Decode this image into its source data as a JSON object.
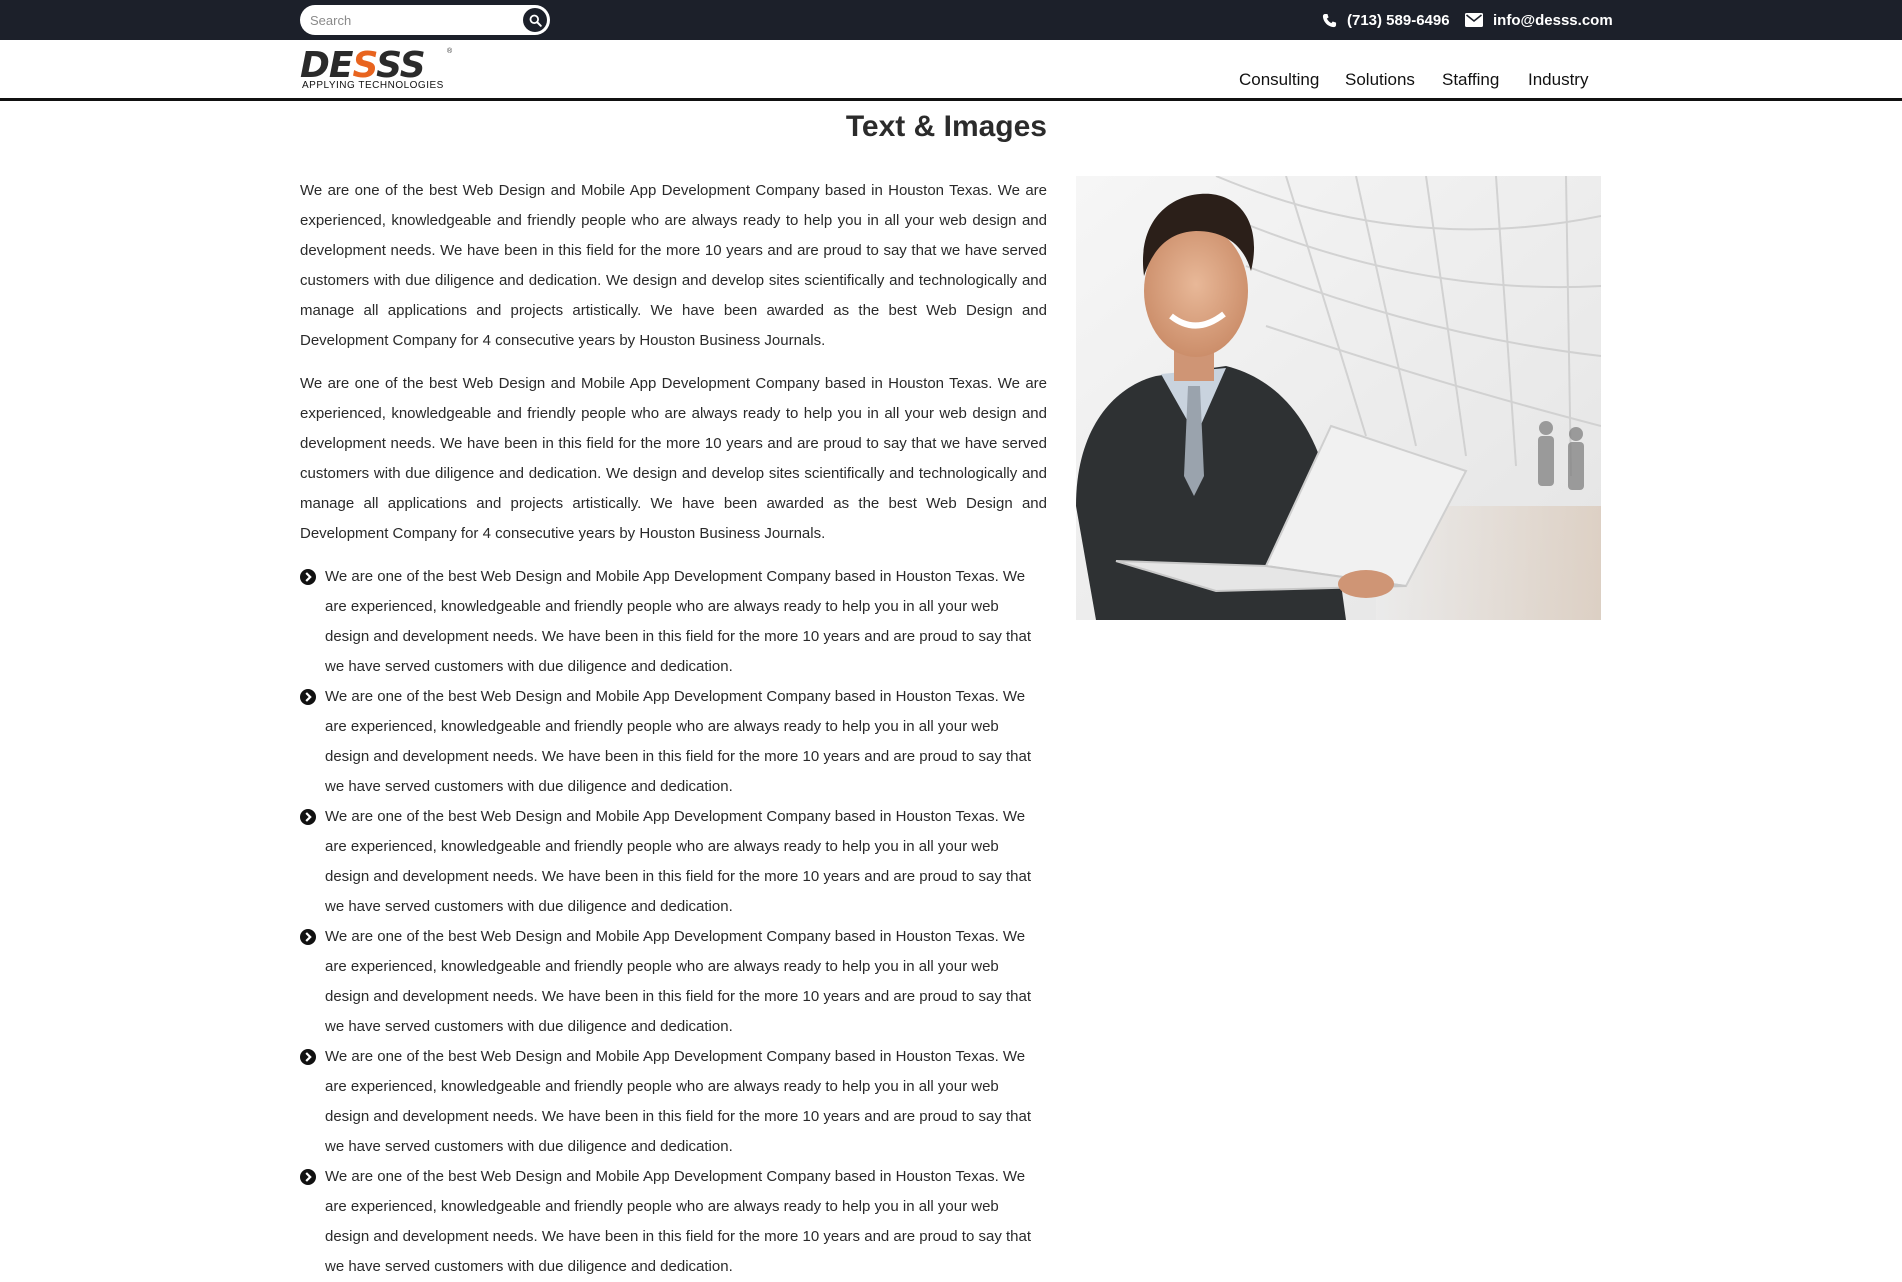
{
  "topbar": {
    "search": {
      "placeholder": "Search",
      "value": ""
    },
    "phone": "(713) 589-6496",
    "email": "info@desss.com"
  },
  "header": {
    "logo": {
      "word_main": "DE",
      "word_accent": "S",
      "word_rest": "SS",
      "tagline": "APPLYING TECHNOLOGIES",
      "reg": "®"
    },
    "nav": [
      "Consulting",
      "Solutions",
      "Staffing",
      "Industry"
    ]
  },
  "main": {
    "title": "Text & Images",
    "paragraphs": [
      "We are one of the best Web Design and Mobile App Development Company based in Houston Texas. We are experienced, knowledgeable and friendly people who are always ready to help you in all your web design and development needs. We have been in this field for the more 10 years and are proud to say that we have served customers with due diligence and dedication. We design and develop sites scientifically and technologically and manage all applications and projects artistically. We have been awarded as the best Web Design and Development Company for 4 consecutive years by Houston Business Journals.",
      "We are one of the best Web Design and Mobile App Development Company based in Houston Texas. We are experienced, knowledgeable and friendly people who are always ready to help you in all your web design and development needs. We have been in this field for the more 10 years and are proud to say that we have served customers with due diligence and dedication. We design and develop sites scientifically and technologically and manage all applications and projects artistically. We have been awarded as the best Web Design and Development Company for 4 consecutive years by Houston Business Journals."
    ],
    "bullets": [
      "We are one of the best Web Design and Mobile App Development Company based in Houston Texas. We are experienced, knowledgeable and friendly people who are always ready to help you in all your web design and development needs. We have been in this field for the more 10 years and are proud to say that we have served customers with due diligence and dedication.",
      "We are one of the best Web Design and Mobile App Development Company based in Houston Texas. We are experienced, knowledgeable and friendly people who are always ready to help you in all your web design and development needs. We have been in this field for the more 10 years and are proud to say that we have served customers with due diligence and dedication.",
      "We are one of the best Web Design and Mobile App Development Company based in Houston Texas. We are experienced, knowledgeable and friendly people who are always ready to help you in all your web design and development needs. We have been in this field for the more 10 years and are proud to say that we have served customers with due diligence and dedication.",
      "We are one of the best Web Design and Mobile App Development Company based in Houston Texas. We are experienced, knowledgeable and friendly people who are always ready to help you in all your web design and development needs. We have been in this field for the more 10 years and are proud to say that we have served customers with due diligence and dedication.",
      "We are one of the best Web Design and Mobile App Development Company based in Houston Texas. We are experienced, knowledgeable and friendly people who are always ready to help you in all your web design and development needs. We have been in this field for the more 10 years and are proud to say that we have served customers with due diligence and dedication.",
      "We are one of the best Web Design and Mobile App Development Company based in Houston Texas. We are experienced, knowledgeable and friendly people who are always ready to help you in all your web design and development needs. We have been in this field for the more 10 years and are proud to say that we have served customers with due diligence and dedication."
    ]
  },
  "icons": {
    "search": "search-icon",
    "phone": "phone-icon",
    "email": "envelope-icon",
    "bullet": "chevron-circle-right-icon"
  },
  "colors": {
    "topbar": "#1c202a",
    "accent": "#e8641f",
    "text": "#2a2a2a"
  }
}
